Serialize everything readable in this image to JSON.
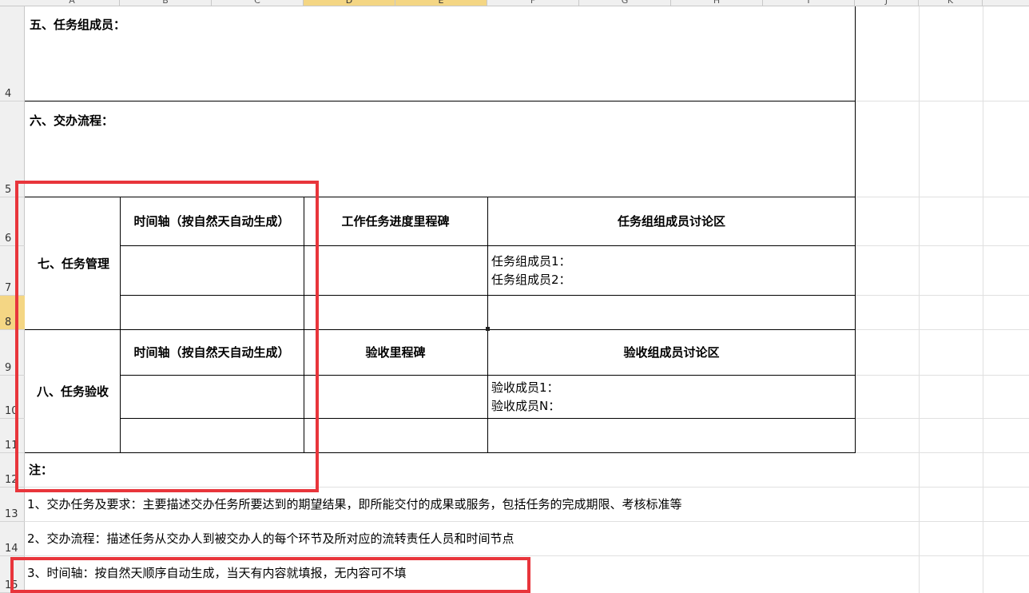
{
  "columns": [
    "A",
    "B",
    "C",
    "D",
    "E",
    "F",
    "G",
    "H",
    "I",
    "J",
    "K"
  ],
  "rows": [
    "4",
    "5",
    "6",
    "7",
    "8",
    "9",
    "10",
    "11",
    "12",
    "13",
    "14",
    "15"
  ],
  "sections": {
    "members_title": "五、任务组成员：",
    "process_title": "六、交办流程：",
    "task_mgmt": {
      "label": "七、任务管理",
      "timeline_header": "时间轴（按自然天自动生成）",
      "milestone_header": "工作任务进度里程碑",
      "discussion_header": "任务组组成员讨论区",
      "member1": "任务组成员1：",
      "member2": "任务组成员2："
    },
    "acceptance": {
      "label": "八、任务验收",
      "timeline_header": "时间轴（按自然天自动生成）",
      "milestone_header": "验收里程碑",
      "discussion_header": "验收组成员讨论区",
      "member1": "验收成员1：",
      "memberN": "验收成员N："
    },
    "notes_title": "注：",
    "note1": "1、交办任务及要求：主要描述交办任务所要达到的期望结果，即所能交付的成果或服务，包括任务的完成期限、考核标准等",
    "note2": "2、交办流程：描述任务从交办人到被交办人的每个环节及所对应的流转责任人员和时间节点",
    "note3": "3、时间轴：按自然天顺序自动生成，当天有内容就填报，无内容可不填"
  },
  "colors": {
    "highlight_box": "#e8353b",
    "selected_header": "#f4d684"
  }
}
